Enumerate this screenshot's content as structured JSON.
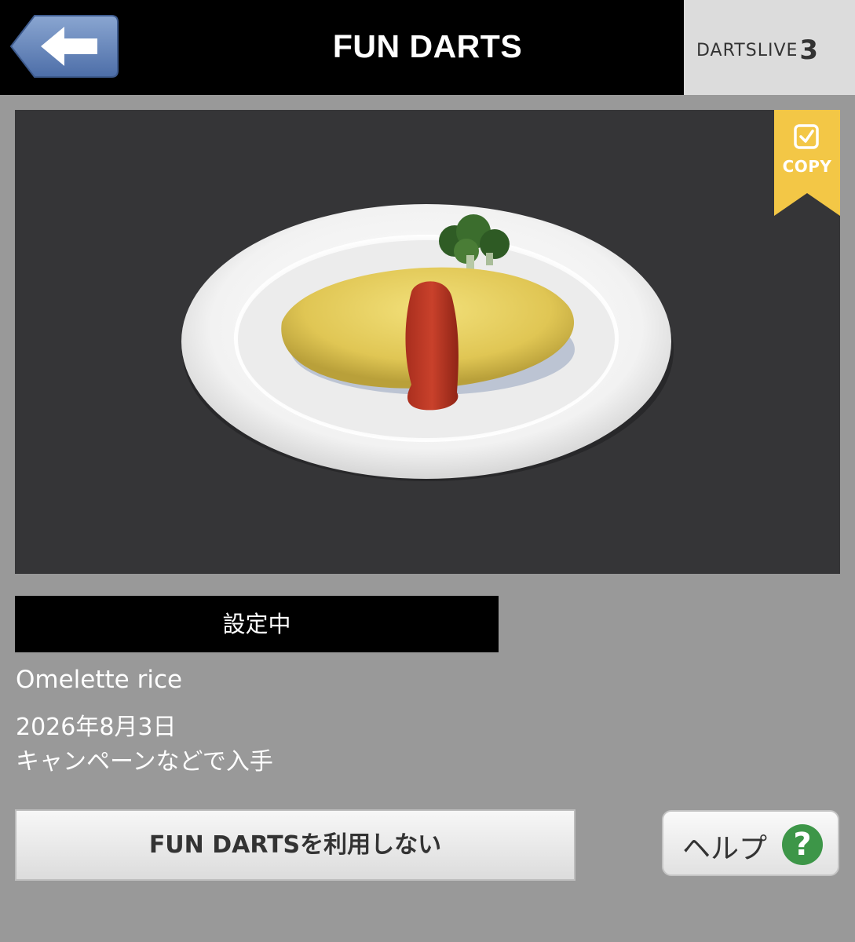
{
  "header": {
    "title": "FUN DARTS",
    "logo_text": "DARTSLIVE",
    "logo_number": "3"
  },
  "preview": {
    "badge_label": "COPY",
    "badge_color": "#f3c746",
    "icons": {
      "back": "left-arrow-icon",
      "badge": "checkbox-icon",
      "help": "question-mark-icon"
    }
  },
  "status": {
    "label": "設定中"
  },
  "item": {
    "name": "Omelette rice",
    "date": "2026年8月3日",
    "source": "キャンペーンなどで入手"
  },
  "actions": {
    "disable_label": "FUN DARTSを利用しない",
    "help_label": "ヘルプ",
    "help_symbol": "?"
  }
}
